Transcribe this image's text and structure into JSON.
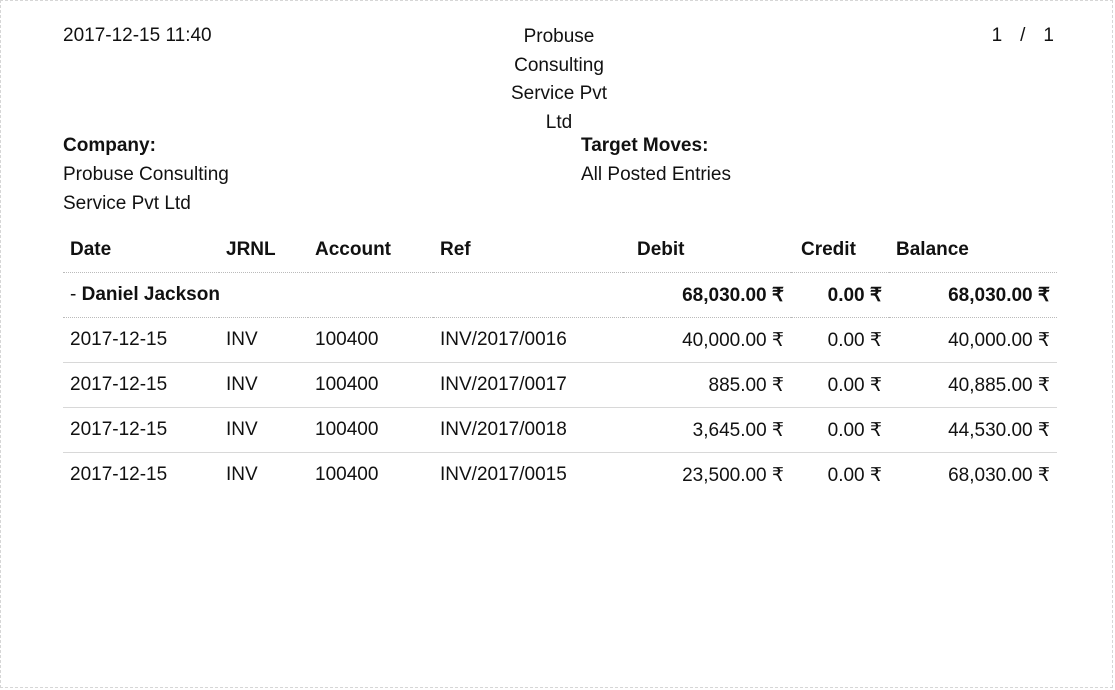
{
  "header": {
    "datetime": "2017-12-15 11:40",
    "company_title_lines": [
      "Probuse",
      "Consulting",
      "Service Pvt",
      "Ltd"
    ],
    "page_current": "1",
    "page_sep": "/",
    "page_total": "1"
  },
  "info": {
    "company_label": "Company:",
    "company_value_lines": [
      "Probuse Consulting",
      "Service Pvt Ltd"
    ],
    "moves_label": "Target Moves:",
    "moves_value": "All Posted Entries"
  },
  "table": {
    "columns": [
      "Date",
      "JRNL",
      "Account",
      "Ref",
      "Debit",
      "Credit",
      "Balance"
    ],
    "partner": {
      "prefix": "- ",
      "name": "Daniel Jackson",
      "debit": "68,030.00 ₹",
      "credit": "0.00 ₹",
      "balance": "68,030.00 ₹"
    },
    "rows": [
      {
        "date": "2017-12-15",
        "jrnl": "INV",
        "account": "100400",
        "ref": "INV/2017/0016",
        "debit": "40,000.00 ₹",
        "credit": "0.00 ₹",
        "balance": "40,000.00 ₹"
      },
      {
        "date": "2017-12-15",
        "jrnl": "INV",
        "account": "100400",
        "ref": "INV/2017/0017",
        "debit": "885.00 ₹",
        "credit": "0.00 ₹",
        "balance": "40,885.00 ₹"
      },
      {
        "date": "2017-12-15",
        "jrnl": "INV",
        "account": "100400",
        "ref": "INV/2017/0018",
        "debit": "3,645.00 ₹",
        "credit": "0.00 ₹",
        "balance": "44,530.00 ₹"
      },
      {
        "date": "2017-12-15",
        "jrnl": "INV",
        "account": "100400",
        "ref": "INV/2017/0015",
        "debit": "23,500.00 ₹",
        "credit": "0.00 ₹",
        "balance": "68,030.00 ₹"
      }
    ]
  }
}
